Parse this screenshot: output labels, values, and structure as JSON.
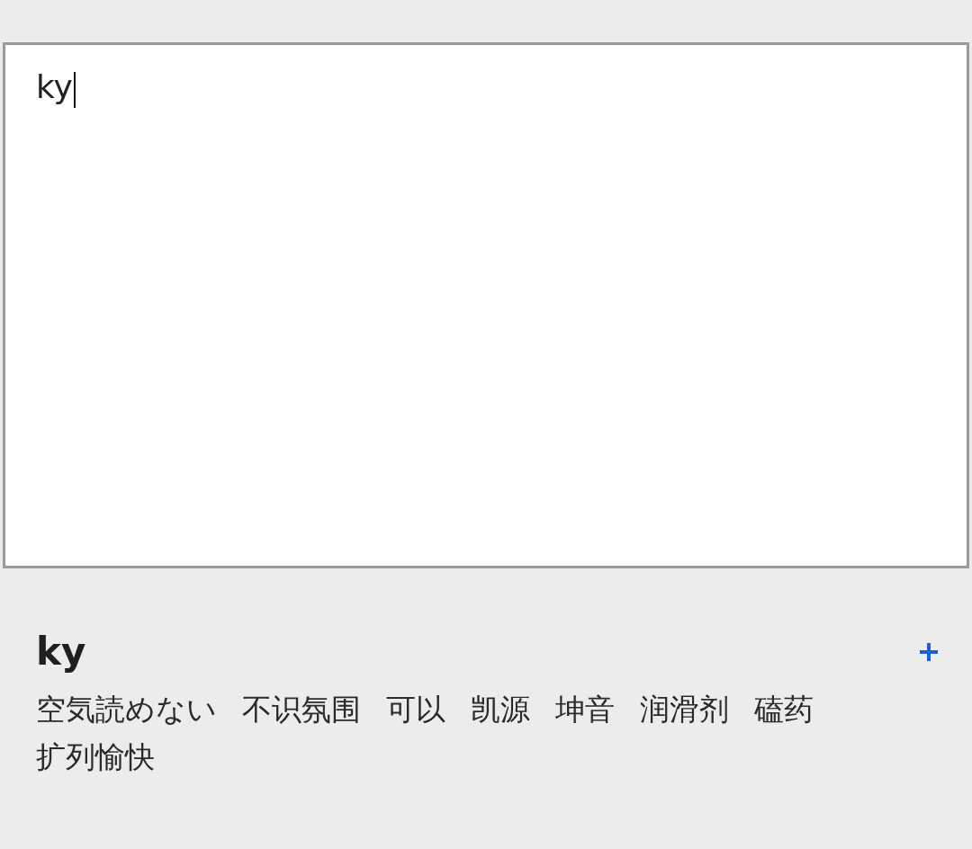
{
  "input": {
    "value": "ky"
  },
  "result": {
    "term": "ky",
    "candidates": [
      "空気読めない",
      "不识氛围",
      "可以",
      "凯源",
      "坤音",
      "润滑剂",
      "磕药",
      "扩列愉快"
    ]
  }
}
